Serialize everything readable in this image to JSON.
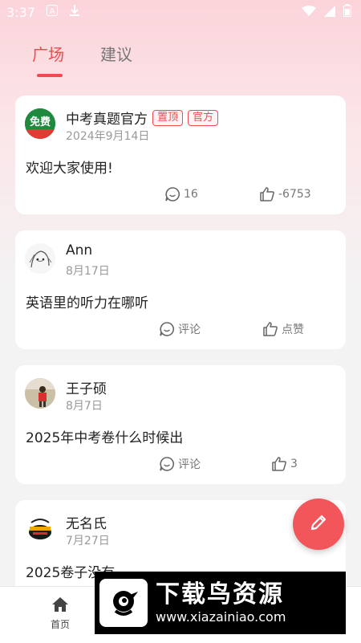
{
  "status_bar": {
    "time": "3:37",
    "icons": [
      "a-notification-icon",
      "download-icon",
      "wifi-icon",
      "signal-icon",
      "battery-icon"
    ]
  },
  "tabs": [
    {
      "label": "广场",
      "active": true
    },
    {
      "label": "建议",
      "active": false
    }
  ],
  "posts": [
    {
      "author": "中考真题官方",
      "badges": [
        "置顶",
        "官方"
      ],
      "date": "2024年9月14日",
      "content": "欢迎大家使用!",
      "comment": "16",
      "like": "-6753",
      "avatar_text": "免费"
    },
    {
      "author": "Ann",
      "badges": [],
      "date": "8月17日",
      "content": "英语里的听力在哪听",
      "comment": "评论",
      "like": "点赞"
    },
    {
      "author": "王子硕",
      "badges": [],
      "date": "8月7日",
      "content": "2025年中考卷什么时候出",
      "comment": "评论",
      "like": "3"
    },
    {
      "author": "无名氏",
      "badges": [],
      "date": "7月27日",
      "content": "2025卷子没有"
    }
  ],
  "bottom_nav": {
    "home_label": "首页"
  },
  "watermark": {
    "title": "下载鸟资源",
    "url": "www.xiazainiao.com"
  },
  "colors": {
    "accent": "#ef4a4f",
    "fab": "#f2555a",
    "header_gradient_top": "#fbd4da",
    "background": "#f3f3f3"
  }
}
